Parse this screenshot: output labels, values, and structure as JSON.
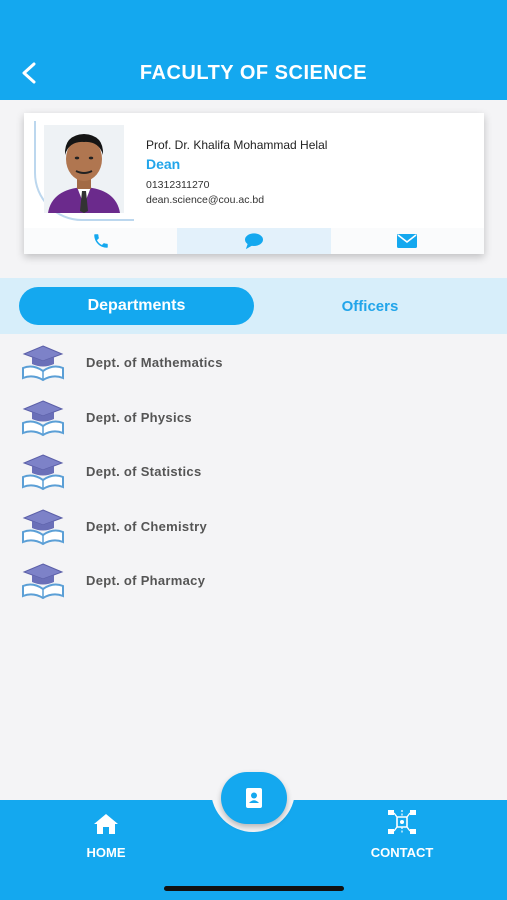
{
  "header": {
    "title": "FACULTY OF SCIENCE",
    "back_icon": "chevron-left-icon"
  },
  "dean": {
    "name": "Prof. Dr. Khalifa Mohammad Helal",
    "title": "Dean",
    "phone": "01312311270",
    "email": "dean.science@cou.ac.bd"
  },
  "actions": [
    "phone-icon",
    "chat-icon",
    "mail-icon"
  ],
  "tabs": {
    "active": "Departments",
    "inactive": "Officers"
  },
  "departments": [
    {
      "label": "Dept. of Mathematics"
    },
    {
      "label": "Dept. of Physics"
    },
    {
      "label": "Dept. of Statistics"
    },
    {
      "label": "Dept. of Chemistry"
    },
    {
      "label": "Dept. of Pharmacy"
    }
  ],
  "bottom_nav": {
    "home": "HOME",
    "contact": "CONTACT"
  },
  "colors": {
    "primary": "#14a8ef",
    "tab_bg": "#d7eefa",
    "accent_text": "#22a5ea"
  }
}
